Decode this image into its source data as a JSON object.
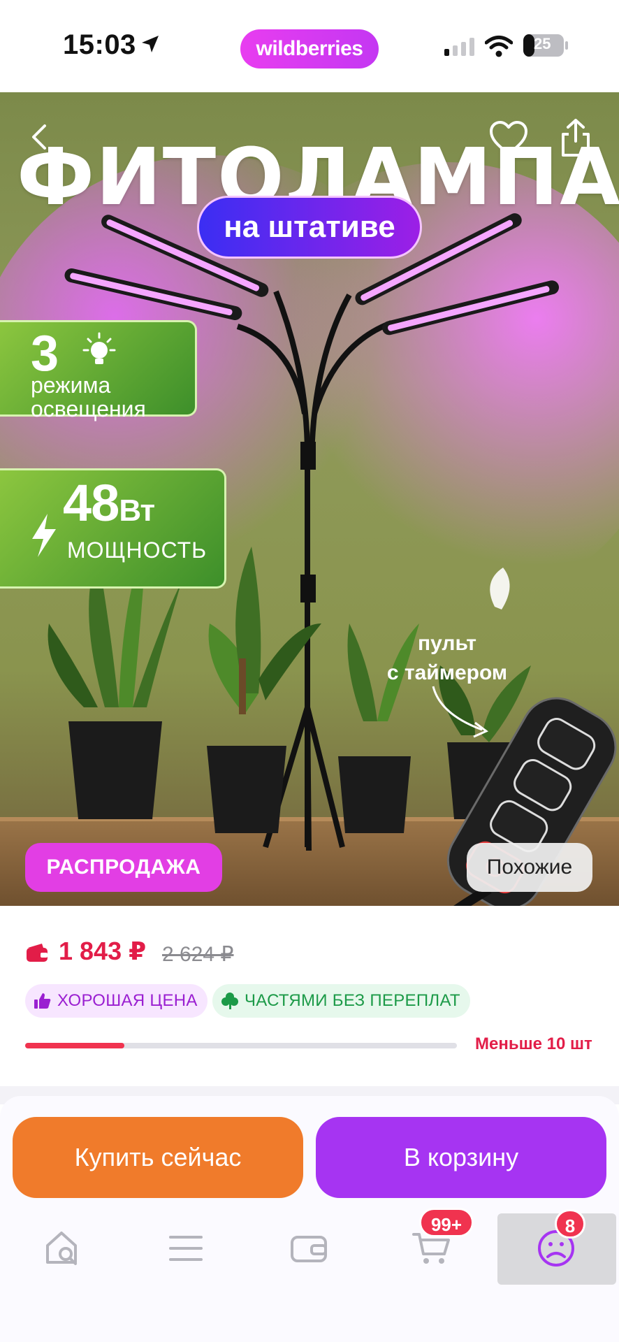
{
  "status_bar": {
    "time": "15:03",
    "brand": "wildberries",
    "battery": "25"
  },
  "product_image": {
    "title": "ФИТОЛАМПА",
    "subtitle_pill": "на штативе",
    "badge_modes": {
      "number": "3",
      "line1": "режима",
      "line2": "освещения"
    },
    "badge_power": {
      "value": "48",
      "unit": "Вт",
      "label": "МОЩНОСТЬ"
    },
    "remote_caption": [
      "пульт",
      "с таймером"
    ],
    "sale_badge": "РАСПРОДАЖА",
    "similar_button": "Похожие",
    "remote_buttons": [
      "±",
      "⟳"
    ]
  },
  "price": {
    "current": "1 843 ₽",
    "old": "2 624 ₽",
    "tags": {
      "good_price": "ХОРОШАЯ ЦЕНА",
      "installments": "ЧАСТЯМИ БЕЗ ПЕРЕПЛАТ"
    },
    "stock_text": "Меньше 10 шт",
    "stock_fraction": 0.23
  },
  "actions": {
    "buy_now": "Купить сейчас",
    "add_to_cart": "В корзину"
  },
  "tab_bar": {
    "cart_count": "99+",
    "profile_count": "8"
  },
  "colors": {
    "brand": "#c437f2",
    "price_red": "#e21d48",
    "buy_orange": "#f07b2b",
    "cart_purple": "#a634f2"
  }
}
